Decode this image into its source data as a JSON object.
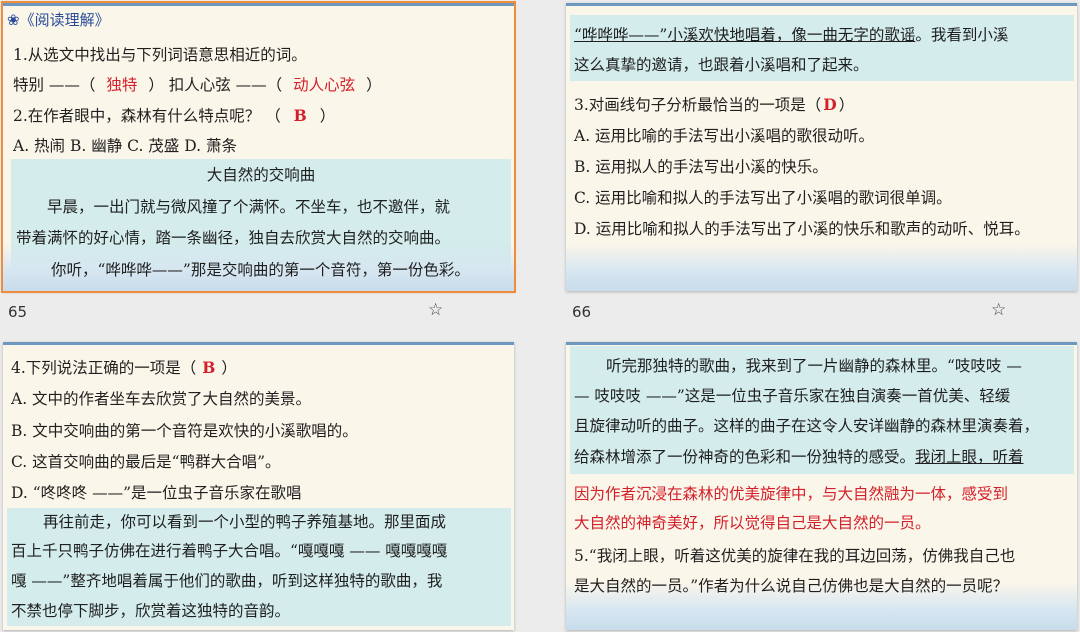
{
  "slide1": {
    "title_icon": "❀",
    "title": "《阅读理解》",
    "q1": "1.从选文中找出与下列词语意思相近的词。",
    "q1_line_a": "特别 ——（",
    "q1_answer_a": "独特",
    "q1_line_b": "） 扣人心弦 ——（",
    "q1_answer_b": "动人心弦",
    "q1_line_c": "）",
    "q2": "2.在作者眼中，森林有什么特点呢？ （",
    "q2_answer": "B",
    "q2_close": "）",
    "q2_options": "A. 热闹 B. 幽静 C. 茂盛 D. 萧条",
    "passage_title": "大自然的交响曲",
    "passage_l1": "早晨，一出门就与微风撞了个满怀。不坐车，也不邀伴，就",
    "passage_l2": "带着满怀的好心情，踏一条幽径，独自去欣赏大自然的交响曲。",
    "passage_l3": "你听，“哗哗哗——”那是交响曲的第一个音符，第一份色彩。",
    "page_number": "65"
  },
  "slide2": {
    "l1_underlined": "“哗哗哗——”小溪欢快地唱着，像一曲无字的歌谣",
    "l1_rest": "。我看到小溪",
    "l2": "这么真挚的邀请，也跟着小溪唱和了起来。",
    "q3": "3.对画线句子分析最恰当的一项是（",
    "q3_answer": "D",
    "q3_close": "）",
    "opt_a": "A. 运用比喻的手法写出小溪唱的歌很动听。",
    "opt_b": "B. 运用拟人的手法写出小溪的快乐。",
    "opt_c": "C. 运用比喻和拟人的手法写出了小溪唱的歌词很单调。",
    "opt_d": "D. 运用比喻和拟人的手法写出了小溪的快乐和歌声的动听、悦耳。",
    "page_number": "66"
  },
  "slide3": {
    "q4": "4.下列说法正确的一项是（",
    "q4_answer": "B",
    "q4_close": "）",
    "opt_a": "A. 文中的作者坐车去欣赏了大自然的美景。",
    "opt_b": "B. 文中交响曲的第一个音符是欢快的小溪歌唱的。",
    "opt_c": "C. 这首交响曲的最后是“鸭群大合唱”。",
    "opt_d": "D. “咚咚咚 ——”是一位虫子音乐家在歌唱",
    "p_l1": "再往前走，你可以看到一个小型的鸭子养殖基地。那里面成",
    "p_l2": "百上千只鸭子仿佛在进行着鸭子大合唱。“嘎嘎嘎 —— 嘎嘎嘎嘎",
    "p_l3": "嘎 ——”整齐地唱着属于他们的歌曲，听到这样独特的歌曲，我",
    "p_l4": "不禁也停下脚步，欣赏着这独特的音韵。"
  },
  "slide4": {
    "p_l1": "听完那独特的歌曲，我来到了一片幽静的森林里。“吱吱吱 —",
    "p_l2": "— 吱吱吱 ——”这是一位虫子音乐家在独自演奏一首优美、轻缓",
    "p_l3": "且旋律动听的曲子。这样的曲子在这令人安详幽静的森林里演奏着，",
    "p_l4_a": "给森林增添了一份神奇的色彩和一份独特的感受。",
    "p_l4_b": "我闭上眼，听着",
    "ans_l1": "因为作者沉浸在森林的优美旋律中，与大自然融为一体，感受到",
    "ans_l2": "大自然的神奇美好，所以觉得自己是大自然的一员。",
    "q5_l1": "5.“我闭上眼，听着这优美的旋律在我的耳边回荡，仿佛我自己也",
    "q5_l2": "是大自然的一员。”作者为什么说自己仿佛也是大自然的一员呢？"
  },
  "colors": {
    "answer_red": "#d4202a",
    "highlight": "#d4ecec",
    "selection": "#f08c3a"
  },
  "icons": {
    "star": "star-icon",
    "title": "flower-icon"
  }
}
